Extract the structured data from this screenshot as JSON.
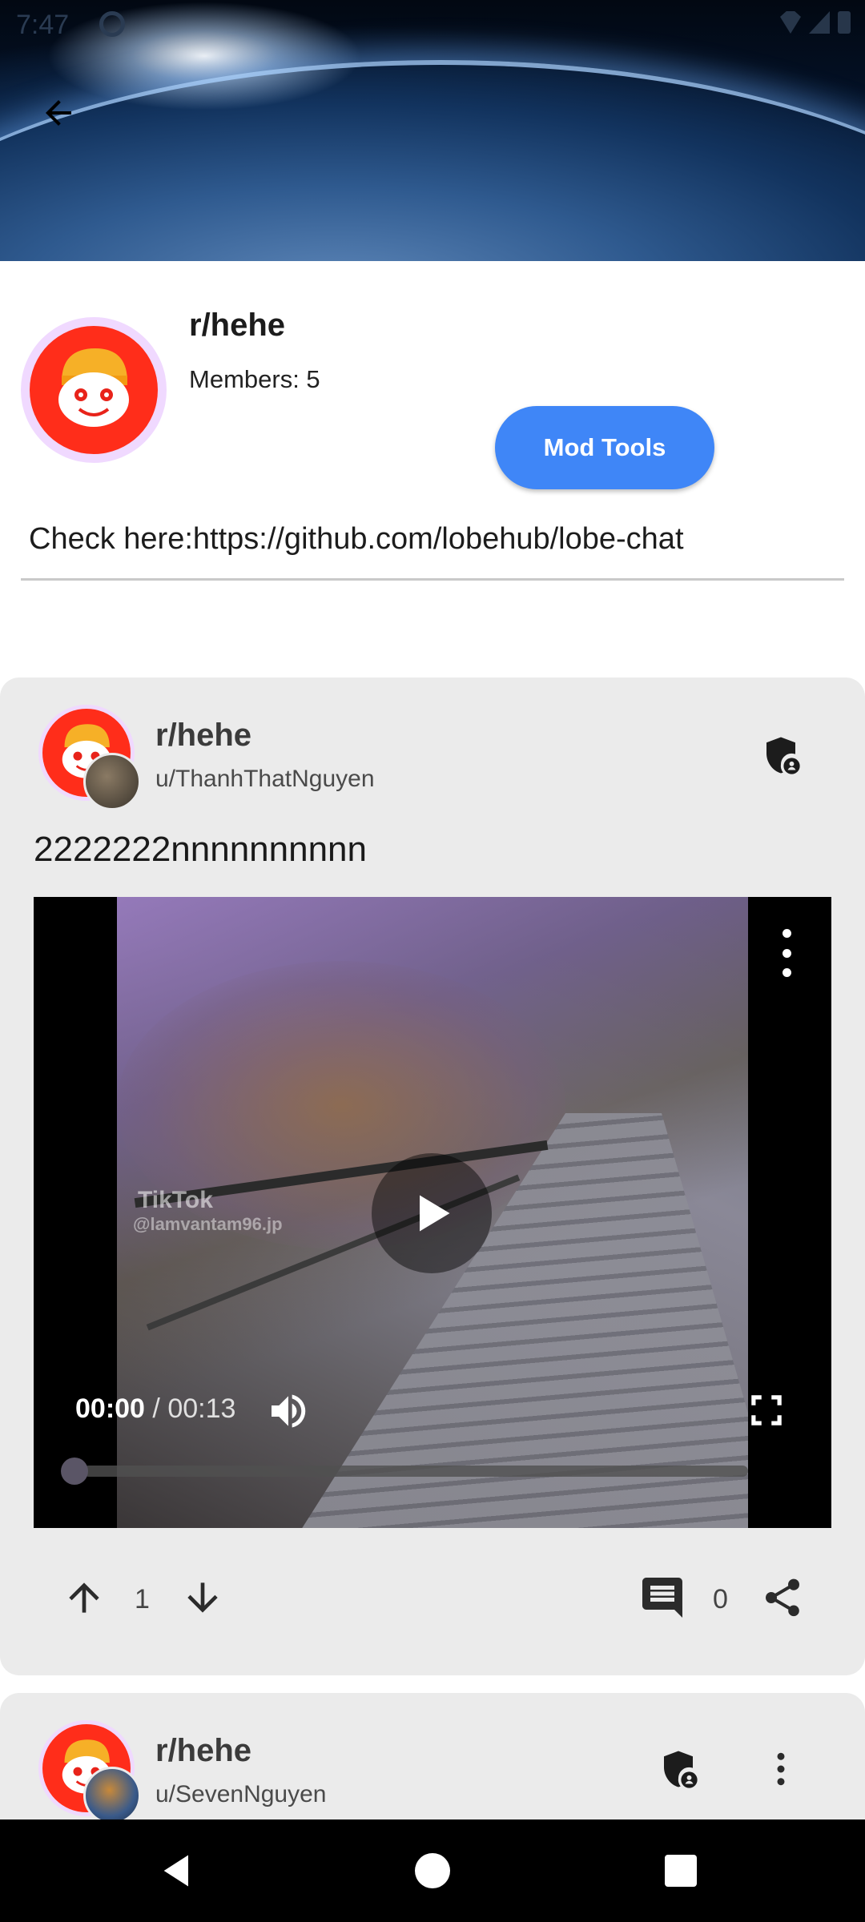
{
  "status_bar": {
    "time": "7:47"
  },
  "community": {
    "name": "r/hehe",
    "members": "Members: 5",
    "mod_tools_label": "Mod Tools",
    "description": "Check here:https://github.com/lobehub/lobe-chat"
  },
  "posts": [
    {
      "subreddit": "r/hehe",
      "user": "u/ThanhThatNguyen",
      "title": "2222222nnnnnnnnnn",
      "video": {
        "watermark_brand": "TikTok",
        "watermark_handle": "@lamvantam96.jp",
        "current_time": "00:00",
        "separator": " / ",
        "total_time": "00:13",
        "progress": 0
      },
      "upvotes": "1",
      "comments": "0"
    },
    {
      "subreddit": "r/hehe",
      "user": "u/SevenNguyen"
    }
  ],
  "icons": {
    "back": "arrow-back-icon",
    "mod_shield": "shield-person-icon",
    "upvote": "arrow-up-icon",
    "downvote": "arrow-down-icon",
    "comment": "comment-icon",
    "share": "share-icon",
    "more": "more-vert-icon",
    "play": "play-icon",
    "volume": "volume-icon",
    "fullscreen": "fullscreen-icon"
  },
  "colors": {
    "accent": "#3f86f7",
    "card_bg": "#ebebeb",
    "avatar_red": "#ff2d1a"
  }
}
